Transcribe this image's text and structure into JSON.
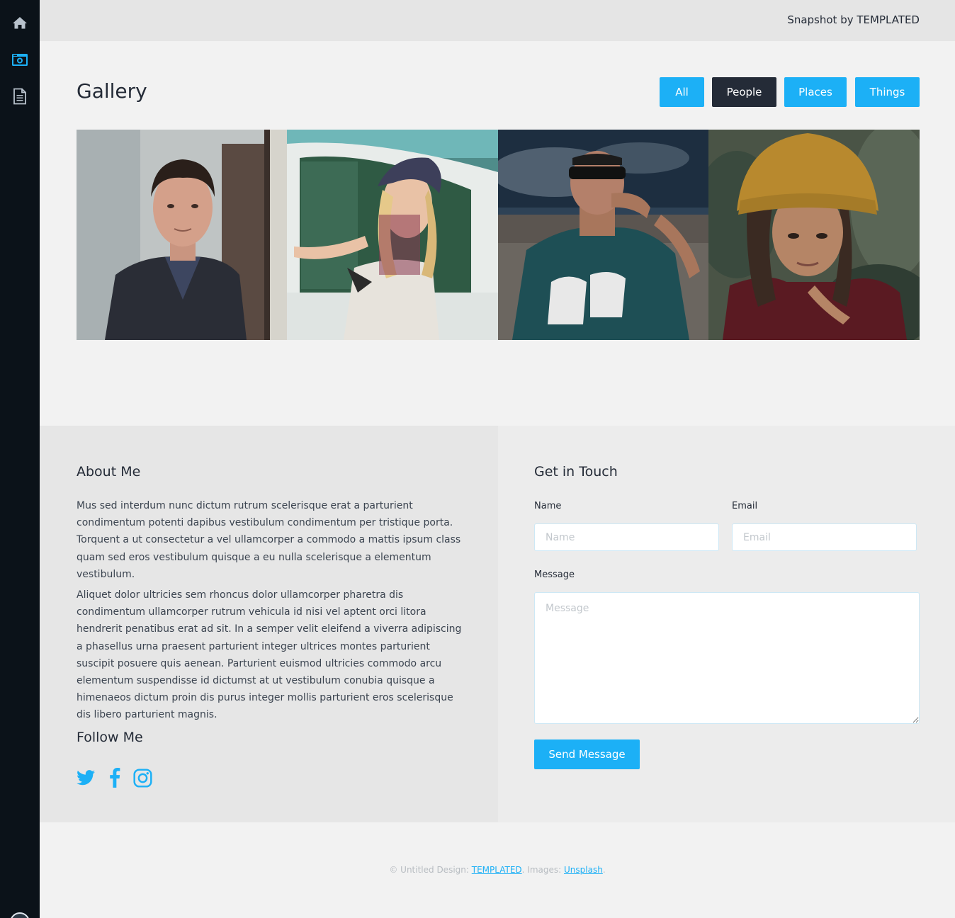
{
  "colors": {
    "accent": "#1cb0f6",
    "dark": "#242b37",
    "sidebar": "#0b1219"
  },
  "sidebar": {
    "items": [
      {
        "icon": "home-icon"
      },
      {
        "icon": "camera-icon",
        "active": true
      },
      {
        "icon": "document-icon"
      }
    ]
  },
  "header": {
    "brand": "Snapshot by TEMPLATED"
  },
  "gallery": {
    "title": "Gallery",
    "filters": [
      {
        "label": "All",
        "active": false
      },
      {
        "label": "People",
        "active": true
      },
      {
        "label": "Places",
        "active": false
      },
      {
        "label": "Things",
        "active": false
      }
    ]
  },
  "about": {
    "title": "About Me",
    "paragraphs": [
      "Mus sed interdum nunc dictum rutrum scelerisque erat a parturient condimentum potenti dapibus vestibulum condimentum per tristique porta. Torquent a ut consectetur a vel ullamcorper a commodo a mattis ipsum class quam sed eros vestibulum quisque a eu nulla scelerisque a elementum vestibulum.",
      "Aliquet dolor ultricies sem rhoncus dolor ullamcorper pharetra dis condimentum ullamcorper rutrum vehicula id nisi vel aptent orci litora hendrerit penatibus erat ad sit. In a semper velit eleifend a viverra adipiscing a phasellus urna praesent parturient integer ultrices montes parturient suscipit posuere quis aenean. Parturient euismod ultricies commodo arcu elementum suspendisse id dictumst at ut vestibulum conubia quisque a himenaeos dictum proin dis purus integer mollis parturient eros scelerisque dis libero parturient magnis."
    ],
    "follow_title": "Follow Me",
    "social": [
      "twitter-icon",
      "facebook-icon",
      "instagram-icon"
    ]
  },
  "contact": {
    "title": "Get in Touch",
    "name_label": "Name",
    "name_placeholder": "Name",
    "email_label": "Email",
    "email_placeholder": "Email",
    "message_label": "Message",
    "message_placeholder": "Message",
    "send_label": "Send Message"
  },
  "footer": {
    "copyright": "© Untitled Design:",
    "templated_link": "TEMPLATED",
    "images_text": ". Images:",
    "unsplash_link": "Unsplash",
    "end": "."
  }
}
